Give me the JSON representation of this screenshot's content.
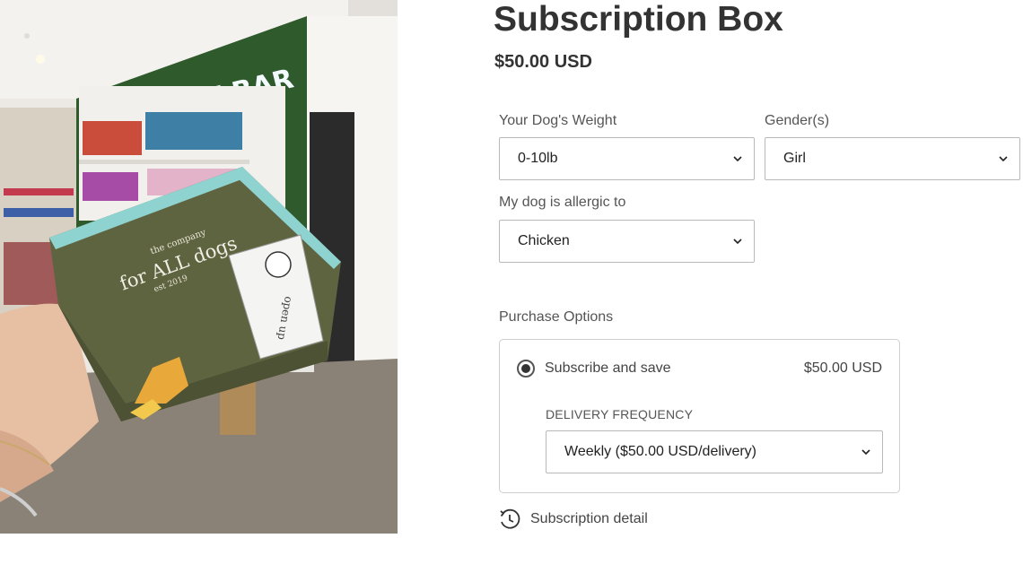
{
  "photo": {
    "neon_sign": "SNACK BAR",
    "box_brand_small": "the company",
    "box_brand": "for ALL dogs",
    "box_brand_est": "est 2019",
    "sleeve_text": "open up",
    "colors": {
      "box": "#5f6440",
      "box_edge": "#8fd3d0",
      "wall_green": "#2f5a2c",
      "floor": "#8a8276"
    }
  },
  "product": {
    "title": "Subscription Box",
    "price": "$50.00 USD"
  },
  "options": {
    "weight": {
      "label": "Your Dog's Weight",
      "value": "0-10lb"
    },
    "gender": {
      "label": "Gender(s)",
      "value": "Girl"
    },
    "allergy": {
      "label": "My dog is allergic to",
      "value": "Chicken"
    }
  },
  "purchase": {
    "label": "Purchase Options",
    "option_label": "Subscribe and save",
    "option_price": "$50.00 USD",
    "frequency_label": "DELIVERY FREQUENCY",
    "frequency_value": "Weekly ($50.00 USD/delivery)"
  },
  "subscription_detail": "Subscription detail",
  "icons": {
    "dropdown": "chevron-down-icon",
    "clock": "clock-icon",
    "radio": "radio-selected"
  }
}
